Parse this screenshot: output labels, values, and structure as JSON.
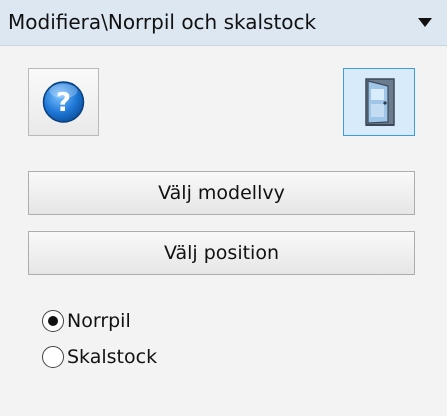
{
  "panel": {
    "title": "Modifiera\\Norrpil och skalstock",
    "dropdown_icon": "chevron-down-icon"
  },
  "toolbar": {
    "help_icon": "help-icon",
    "exit_icon": "door-exit-icon"
  },
  "buttons": {
    "choose_modelview": "Välj modellvy",
    "choose_position": "Välj position"
  },
  "options": {
    "selected": "Norrpil",
    "items": [
      {
        "label": "Norrpil",
        "checked": true
      },
      {
        "label": "Skalstock",
        "checked": false
      }
    ]
  },
  "colors": {
    "title_bar": "#dde7f2",
    "panel_bg": "#f3f3f3",
    "active_button_border": "#3f9be6",
    "active_button_bg": "#d7ebfb",
    "help_icon": "#1e78d6"
  }
}
